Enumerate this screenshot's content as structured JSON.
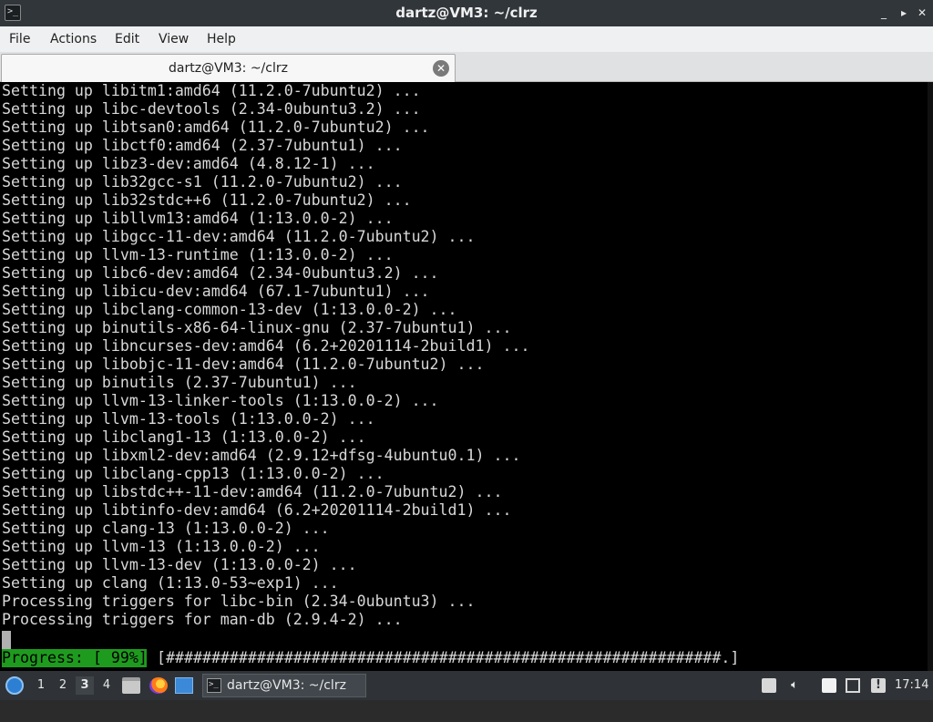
{
  "window": {
    "title": "dartz@VM3: ~/clrz",
    "controls": [
      "_",
      "▸",
      "✕"
    ]
  },
  "menu": [
    "File",
    "Actions",
    "Edit",
    "View",
    "Help"
  ],
  "tab": {
    "label": "dartz@VM3: ~/clrz",
    "close": "✕"
  },
  "terminal": {
    "lines": [
      "Setting up libitm1:amd64 (11.2.0-7ubuntu2) ...",
      "Setting up libc-devtools (2.34-0ubuntu3.2) ...",
      "Setting up libtsan0:amd64 (11.2.0-7ubuntu2) ...",
      "Setting up libctf0:amd64 (2.37-7ubuntu1) ...",
      "Setting up libz3-dev:amd64 (4.8.12-1) ...",
      "Setting up lib32gcc-s1 (11.2.0-7ubuntu2) ...",
      "Setting up lib32stdc++6 (11.2.0-7ubuntu2) ...",
      "Setting up libllvm13:amd64 (1:13.0.0-2) ...",
      "Setting up libgcc-11-dev:amd64 (11.2.0-7ubuntu2) ...",
      "Setting up llvm-13-runtime (1:13.0.0-2) ...",
      "Setting up libc6-dev:amd64 (2.34-0ubuntu3.2) ...",
      "Setting up libicu-dev:amd64 (67.1-7ubuntu1) ...",
      "Setting up libclang-common-13-dev (1:13.0.0-2) ...",
      "Setting up binutils-x86-64-linux-gnu (2.37-7ubuntu1) ...",
      "Setting up libncurses-dev:amd64 (6.2+20201114-2build1) ...",
      "Setting up libobjc-11-dev:amd64 (11.2.0-7ubuntu2) ...",
      "Setting up binutils (2.37-7ubuntu1) ...",
      "Setting up llvm-13-linker-tools (1:13.0.0-2) ...",
      "Setting up llvm-13-tools (1:13.0.0-2) ...",
      "Setting up libclang1-13 (1:13.0.0-2) ...",
      "Setting up libxml2-dev:amd64 (2.9.12+dfsg-4ubuntu0.1) ...",
      "Setting up libclang-cpp13 (1:13.0.0-2) ...",
      "Setting up libstdc++-11-dev:amd64 (11.2.0-7ubuntu2) ...",
      "Setting up libtinfo-dev:amd64 (6.2+20201114-2build1) ...",
      "Setting up clang-13 (1:13.0.0-2) ...",
      "Setting up llvm-13 (1:13.0.0-2) ...",
      "Setting up llvm-13-dev (1:13.0.0-2) ...",
      "Setting up clang (1:13.0-53~exp1) ...",
      "Processing triggers for libc-bin (2.34-0ubuntu3) ...",
      "Processing triggers for man-db (2.9.4-2) ..."
    ],
    "progress_label": "Progress: [ 99%]",
    "progress_bar": "[#############################################################.]",
    "progress_percent": 99
  },
  "taskbar": {
    "desktops": [
      "1",
      "2",
      "3",
      "4"
    ],
    "active_desktop": "3",
    "task_label": "dartz@VM3: ~/clrz",
    "clock": "17:14"
  },
  "icons": {
    "start": "lxqt-start-icon",
    "files": "file-manager-icon",
    "browser": "firefox-icon",
    "window": "show-desktop-icon",
    "terminal": "terminal-icon",
    "keyboard": "keyboard-layout-icon",
    "volume": "volume-icon",
    "clipboard": "clipboard-icon",
    "network": "network-icon",
    "notifications": "notification-icon"
  },
  "colors": {
    "terminal_bg": "#000000",
    "terminal_fg": "#d8d8d8",
    "progress_green": "#1e9b1e",
    "taskbar_bg": "#2f3337"
  }
}
